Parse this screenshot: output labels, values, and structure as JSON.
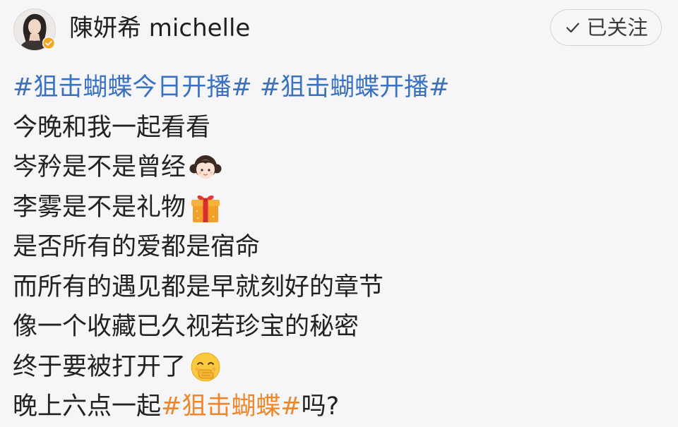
{
  "header": {
    "username": "陳妍希 michelle",
    "follow_label": "已关注"
  },
  "post": {
    "topics_line": [
      {
        "text": "#狙击蝴蝶今日开播#",
        "type": "topic"
      },
      {
        "text": " ",
        "type": "text"
      },
      {
        "text": "#狙击蝴蝶开播#",
        "type": "topic"
      }
    ],
    "lines": [
      {
        "text": "今晚和我一起看看",
        "emoji": null
      },
      {
        "text": "岑矜是不是曾经",
        "emoji": "girl-emoji"
      },
      {
        "text": "李雾是不是礼物",
        "emoji": "gift-emoji"
      },
      {
        "text": "是否所有的爱都是宿命",
        "emoji": null
      },
      {
        "text": "而所有的遇见都是早就刻好的章节",
        "emoji": null
      },
      {
        "text": "像一个收藏已久视若珍宝的秘密",
        "emoji": null
      },
      {
        "text": "终于要被打开了",
        "emoji": "hand-over-mouth-emoji"
      }
    ],
    "last_line": {
      "prefix": "晚上六点一起",
      "topic": "#狙击蝴蝶#",
      "suffix": "吗?"
    }
  },
  "colors": {
    "background": "#f6f6f8",
    "topic_blue": "#3b71c1",
    "topic_orange": "#f0862a",
    "verified_badge": "#f5a623"
  },
  "icons": [
    "avatar",
    "verified-badge-icon",
    "check-icon",
    "girl-emoji",
    "gift-emoji",
    "hand-over-mouth-emoji"
  ]
}
